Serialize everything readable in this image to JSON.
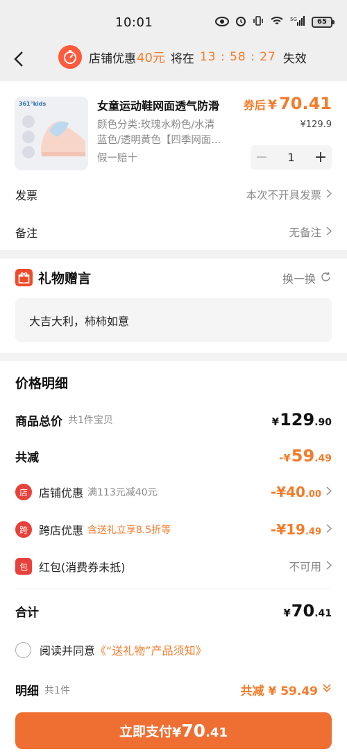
{
  "status_bar": {
    "time": "10:01",
    "battery": "65"
  },
  "nav": {
    "promo_prefix": "店铺优惠",
    "promo_amount": "40元",
    "promo_mid": "将在",
    "promo_timer": "13 : 58 : 27",
    "promo_suffix": "失效"
  },
  "product": {
    "brand_logo": "361°kids",
    "title": "女童运动鞋网面透气防滑",
    "spec_line1": "颜色分类:玫瑰水粉色/水清",
    "spec_line2": "蓝色/透明黄色【四季网面...",
    "tag": "假一赔十",
    "price_after_label": "券后",
    "price_after_yen": "¥",
    "price_after_value": "70.41",
    "price_original": "¥129.9",
    "quantity": "1"
  },
  "invoice": {
    "label": "发票",
    "value": "本次不开具发票"
  },
  "remark": {
    "label": "备注",
    "value": "无备注"
  },
  "gift": {
    "title": "礼物赠言",
    "switch_label": "换一换",
    "message": "大吉大利，柿柿如意"
  },
  "price_detail": {
    "title": "价格明细",
    "total": {
      "label": "商品总价",
      "sub": "共1件宝贝",
      "yen": "¥",
      "int": "129",
      "dec": ".90"
    },
    "reduction": {
      "label": "共减",
      "prefix": "-¥",
      "int": "59",
      "dec": ".49"
    },
    "discounts": [
      {
        "icon_text": "店",
        "label": "店铺优惠",
        "sub": "满113元减40元",
        "value_int": "-¥40",
        "value_dec": ".00"
      },
      {
        "icon_text": "跨",
        "label": "跨店优惠",
        "sub": "含送礼立享8.5折等",
        "value_int": "-¥19",
        "value_dec": ".49"
      },
      {
        "icon_text": "包",
        "label": "红包(消费券未抵)",
        "sub": "",
        "value_text": "不可用"
      }
    ],
    "sum": {
      "label": "合计",
      "yen": "¥",
      "int": "70",
      "dec": ".41"
    }
  },
  "agreement": {
    "prefix": "阅读并同意",
    "link": "《“送礼物”产品须知》"
  },
  "summary": {
    "label": "明细",
    "sub": "共1件",
    "right_text": "共减 ¥ 59.49"
  },
  "pay_button": {
    "label": "立即支付",
    "yen": "¥",
    "int": "70",
    "dec": ".41"
  },
  "colors": {
    "accent": "#f47b2a",
    "pay_button": "#ef6f33",
    "discount_icon": "#e8403a"
  }
}
